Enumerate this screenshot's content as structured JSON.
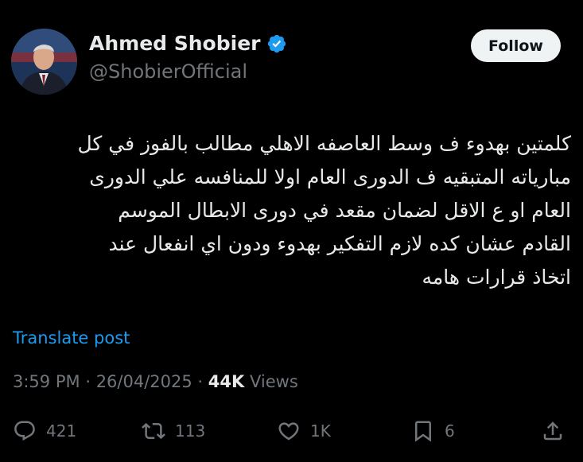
{
  "author": {
    "display_name": "Ahmed Shobier",
    "handle": "@ShobierOfficial",
    "verified": true,
    "verified_color": "#1d9bf0"
  },
  "follow_button": {
    "label": "Follow"
  },
  "tweet": {
    "text": "كلمتين بهدوء ف وسط العاصفه الاهلي مطالب بالفوز في كل\nمبارياته المتبقيه ف الدورى العام اولا للمنافسه علي الدورى\nالعام او ع الاقل لضمان مقعد في دورى الابطال الموسم\nالقادم عشان كده لازم التفكير بهدوء ودون اي انفعال عند\nاتخاذ قرارات هامه",
    "translate_label": "Translate post"
  },
  "meta": {
    "time": "3:59 PM",
    "separator": "·",
    "date": "26/04/2025",
    "views_count": "44K",
    "views_label": "Views"
  },
  "actions": {
    "replies": "421",
    "reposts": "113",
    "likes": "1K",
    "bookmarks": "6"
  },
  "colors": {
    "background": "#000000",
    "text": "#e7e9ea",
    "secondary": "#71767b",
    "link": "#1d9bf0"
  }
}
